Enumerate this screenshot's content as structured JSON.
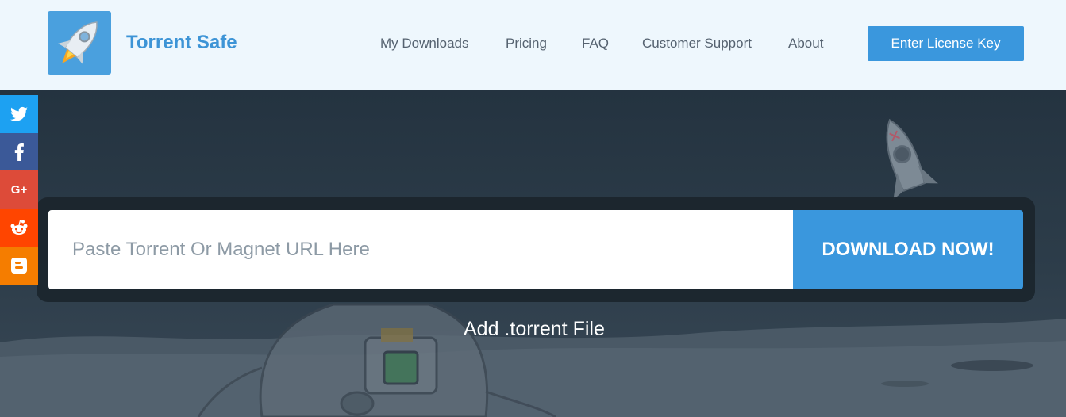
{
  "header": {
    "brand": "Torrent Safe",
    "logo_icon": "rocket-icon",
    "nav": [
      {
        "label": "My Downloads"
      },
      {
        "label": "Pricing"
      },
      {
        "label": "FAQ"
      },
      {
        "label": "Customer Support"
      },
      {
        "label": "About"
      }
    ],
    "license_button": "Enter License Key"
  },
  "social": [
    {
      "name": "twitter",
      "icon": "twitter-icon",
      "color": "#1da1f2"
    },
    {
      "name": "facebook",
      "icon": "facebook-icon",
      "color": "#3b5998"
    },
    {
      "name": "google-plus",
      "icon": "google-plus-icon",
      "color": "#dd4b39"
    },
    {
      "name": "reddit",
      "icon": "reddit-icon",
      "color": "#ff4500"
    },
    {
      "name": "blogger",
      "icon": "blogger-icon",
      "color": "#f57d00"
    }
  ],
  "search": {
    "placeholder": "Paste Torrent Or Magnet URL Here",
    "value": "",
    "button": "DOWNLOAD NOW!"
  },
  "add_file": "Add .torrent File",
  "colors": {
    "accent": "#3a97dd",
    "header_bg": "#eef7fd",
    "hero_bg": "#2a3844"
  }
}
